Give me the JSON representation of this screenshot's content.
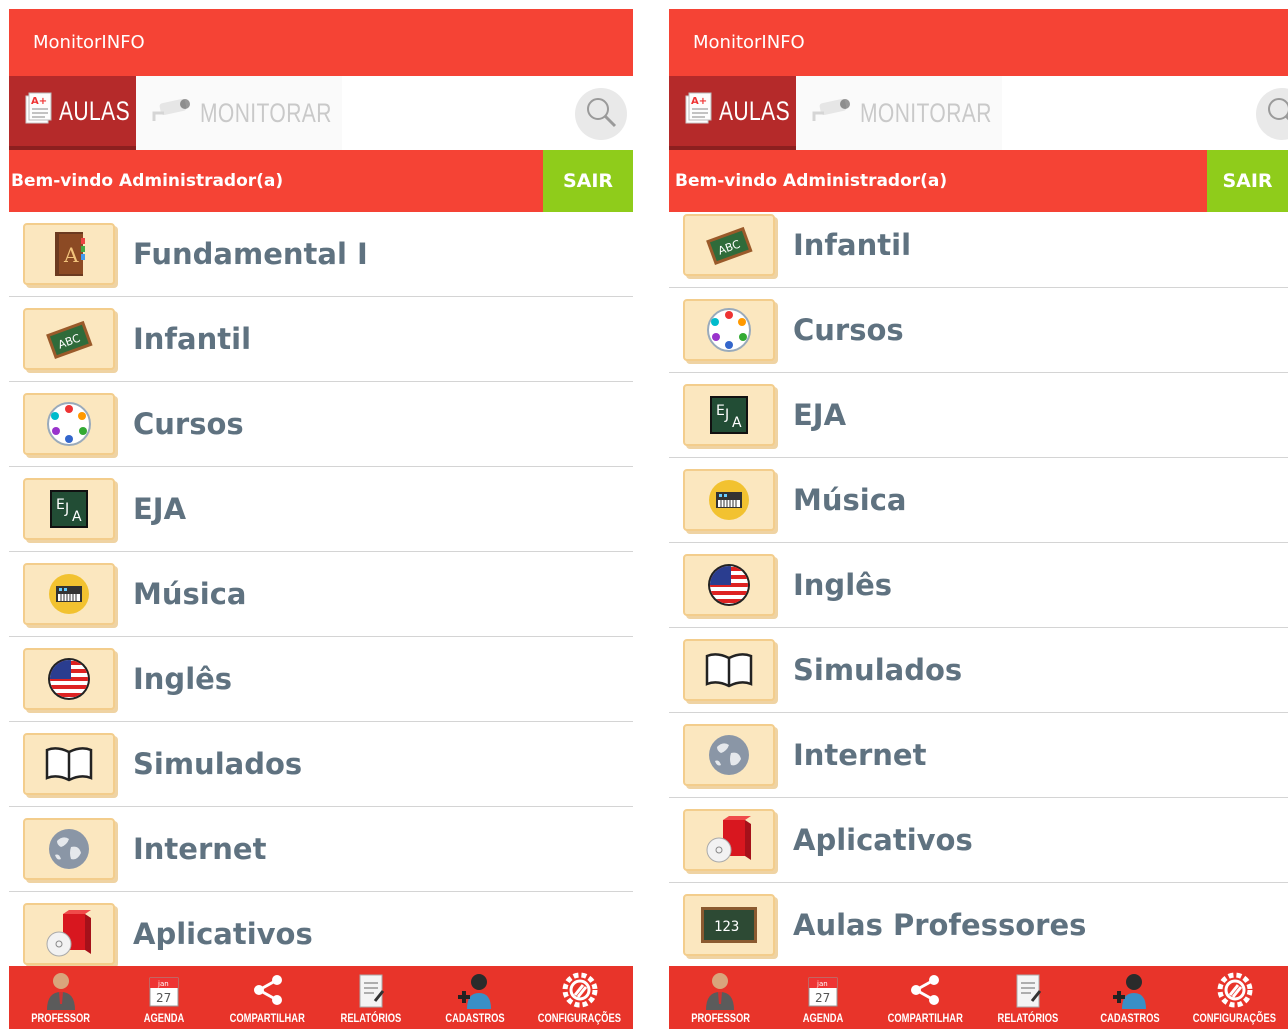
{
  "app": {
    "title": "MonitorINFO",
    "tabs": {
      "aulas": "AULAS",
      "monitorar": "MONITORAR"
    },
    "welcome": "Bem-vindo Administrador(a)",
    "sair": "SAIR"
  },
  "left": {
    "items": [
      {
        "label": "Fundamental I",
        "icon": "notebook-a-icon"
      },
      {
        "label": "Infantil",
        "icon": "chalkboard-abc-icon"
      },
      {
        "label": "Cursos",
        "icon": "hands-circle-icon"
      },
      {
        "label": "EJA",
        "icon": "eja-board-icon"
      },
      {
        "label": "Música",
        "icon": "keyboard-icon"
      },
      {
        "label": "Inglês",
        "icon": "us-flag-icon"
      },
      {
        "label": "Simulados",
        "icon": "open-book-icon"
      },
      {
        "label": "Internet",
        "icon": "globe-icon"
      },
      {
        "label": "Aplicativos",
        "icon": "software-box-icon"
      }
    ]
  },
  "right": {
    "items": [
      {
        "label": "Infantil",
        "icon": "chalkboard-abc-icon"
      },
      {
        "label": "Cursos",
        "icon": "hands-circle-icon"
      },
      {
        "label": "EJA",
        "icon": "eja-board-icon"
      },
      {
        "label": "Música",
        "icon": "keyboard-icon"
      },
      {
        "label": "Inglês",
        "icon": "us-flag-icon"
      },
      {
        "label": "Simulados",
        "icon": "open-book-icon"
      },
      {
        "label": "Internet",
        "icon": "globe-icon"
      },
      {
        "label": "Aplicativos",
        "icon": "software-box-icon"
      },
      {
        "label": "Aulas Professores",
        "icon": "board-123-icon"
      }
    ]
  },
  "nav": {
    "professor": "PROFESSOR",
    "agenda": "AGENDA",
    "agenda_month": "jan",
    "agenda_day": "27",
    "compartilhar": "COMPARTILHAR",
    "relatorios": "RELATÓRIOS",
    "cadastros": "CADASTROS",
    "configuracoes": "CONFIGURAÇÕES"
  },
  "board_123_text": "123",
  "notebook_letter": "A",
  "colors": {
    "header": "#f54335",
    "tab_active": "#b52a2a",
    "sair": "#8fcc1b",
    "nav": "#e8342a",
    "label": "#5f7280",
    "icon_bg": "#fbe7bf"
  }
}
